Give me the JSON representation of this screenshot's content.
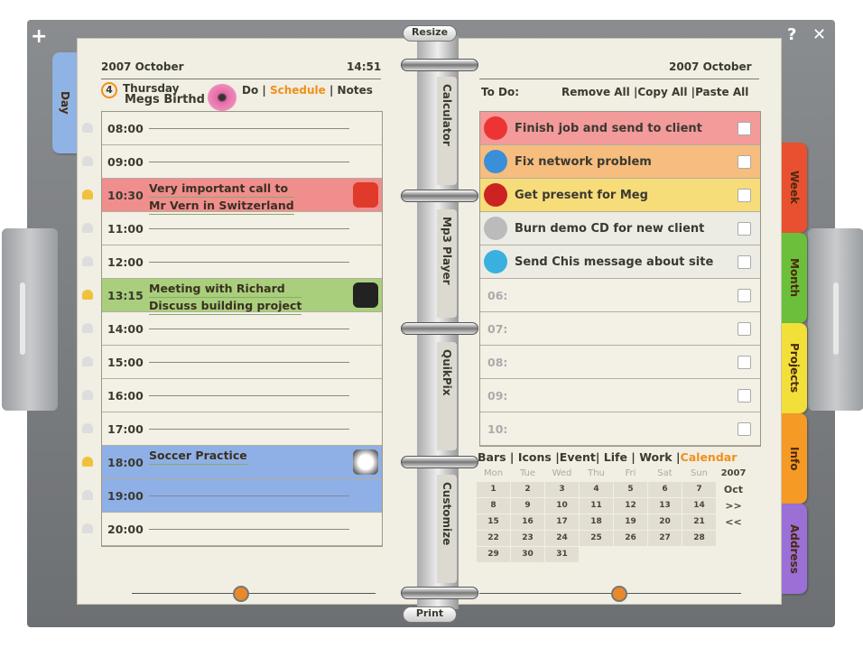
{
  "window": {
    "add_label": "+",
    "help_label": "?",
    "close_label": "✕",
    "resize_label": "Resize",
    "print_label": "Print"
  },
  "left": {
    "year_month": "2007  October",
    "time": "14:51",
    "day_num": "4",
    "weekday": "Thursday",
    "note": "Megs Birthd",
    "views": [
      "Do",
      "Schedule",
      "Notes"
    ],
    "active_view": "Schedule",
    "day_tab": "Day",
    "rows": [
      {
        "time": "08:00"
      },
      {
        "time": "09:00"
      },
      {
        "time": "10:30",
        "color": "#f08e8e",
        "lines": [
          "Very important call to",
          "Mr Vern in Switzerland"
        ],
        "icon": "phone-icon"
      },
      {
        "time": "11:00"
      },
      {
        "time": "12:00"
      },
      {
        "time": "13:15",
        "color": "#a9cf7c",
        "lines": [
          "Meeting with Richard",
          "Discuss building project"
        ],
        "icon": "briefcase-icon"
      },
      {
        "time": "14:00"
      },
      {
        "time": "15:00"
      },
      {
        "time": "16:00"
      },
      {
        "time": "17:00"
      },
      {
        "time": "18:00",
        "color": "#8fb0e6",
        "lines": [
          "Soccer Practice"
        ],
        "icon": "soccer-ball-icon"
      },
      {
        "time": "19:00",
        "color": "#8fb0e6"
      },
      {
        "time": "20:00"
      }
    ]
  },
  "spine_tabs": [
    "Calculator",
    "Mp3 Player",
    "QuikPix",
    "Customize"
  ],
  "right": {
    "year_month": "2007  October",
    "todo_label": "To Do:",
    "actions": [
      "Remove All",
      "Copy All",
      "Paste All"
    ],
    "todos": [
      {
        "text": "Finish job and send to client",
        "color": "#f39a9a",
        "icon": "star-icon"
      },
      {
        "text": "Fix network problem",
        "color": "#f6bd7e",
        "icon": "network-icon"
      },
      {
        "text": "Get present for Meg",
        "color": "#f7dc7a",
        "icon": "gift-icon"
      },
      {
        "text": "Burn demo CD for new client",
        "color": "#ecebe4",
        "icon": "cd-icon"
      },
      {
        "text": "Send Chis message about site",
        "color": "#ecebe4",
        "icon": "user-icon"
      },
      {
        "text": "06:"
      },
      {
        "text": "07:"
      },
      {
        "text": "08:"
      },
      {
        "text": "09:"
      },
      {
        "text": "10:"
      }
    ],
    "cal_tabs": [
      "Bars",
      "Icons",
      "Event",
      "Life",
      "Work",
      "Calendar"
    ],
    "active_cal_tab": "Calendar",
    "weekdays": [
      "Mon",
      "Tue",
      "Wed",
      "Thu",
      "Fri",
      "Sat",
      "Sun"
    ],
    "cal_year": "2007",
    "cal_month": "Oct",
    "next": ">>",
    "prev": "<<",
    "weeks": [
      [
        "1",
        "2",
        "3",
        "4",
        "5",
        "6",
        "7"
      ],
      [
        "8",
        "9",
        "10",
        "11",
        "12",
        "13",
        "14"
      ],
      [
        "15",
        "16",
        "17",
        "18",
        "19",
        "20",
        "21"
      ],
      [
        "22",
        "23",
        "24",
        "25",
        "26",
        "27",
        "28"
      ],
      [
        "29",
        "30",
        "31"
      ]
    ]
  },
  "side_tabs": [
    {
      "label": "Week",
      "color": "#e9502f"
    },
    {
      "label": "Month",
      "color": "#6cbf3a"
    },
    {
      "label": "Projects",
      "color": "#f2df3a"
    },
    {
      "label": "Info",
      "color": "#f59a25"
    },
    {
      "label": "Address",
      "color": "#9a6fd6"
    }
  ]
}
